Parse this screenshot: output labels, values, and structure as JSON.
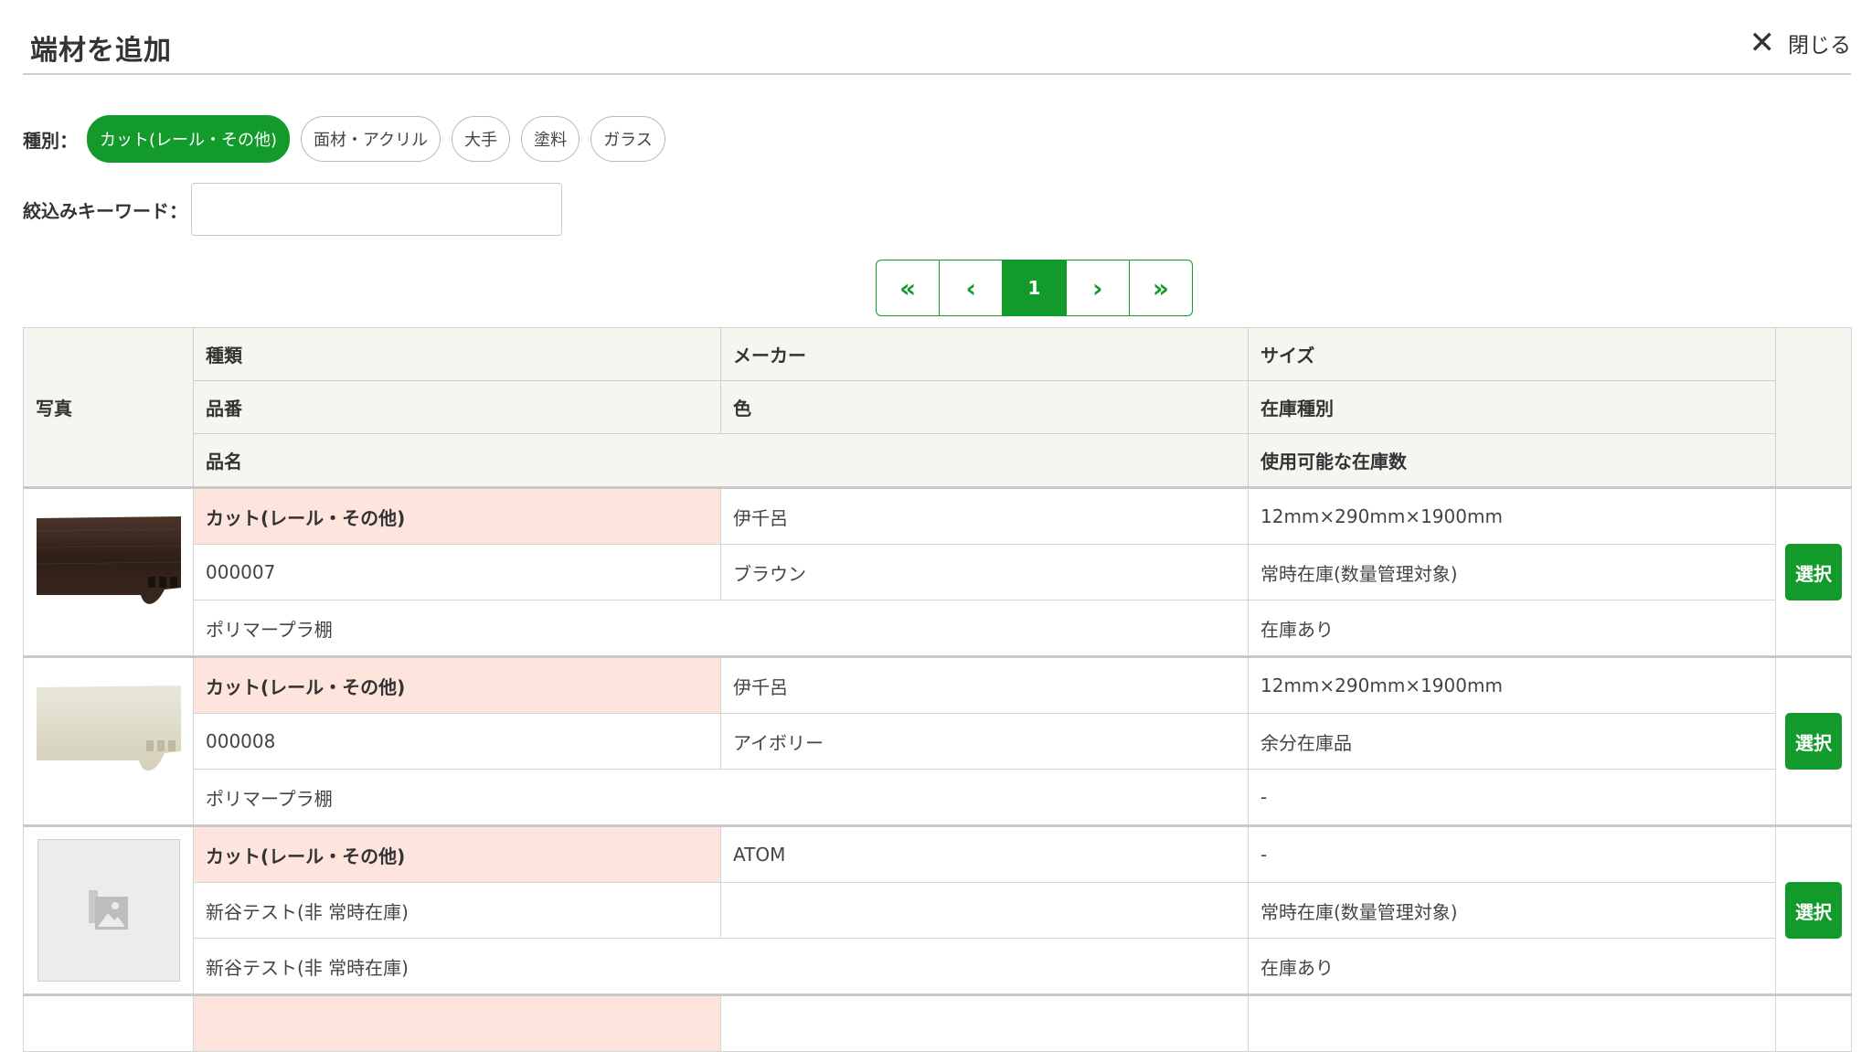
{
  "modal": {
    "title": "端材を追加",
    "close_label": "閉じる",
    "close_icon": "close-icon"
  },
  "filters": {
    "type_label": "種別：",
    "types": [
      {
        "label": "カット(レール・その他)",
        "active": true
      },
      {
        "label": "面材・アクリル",
        "active": false
      },
      {
        "label": "大手",
        "active": false
      },
      {
        "label": "塗料",
        "active": false
      },
      {
        "label": "ガラス",
        "active": false
      }
    ],
    "keyword_label": "絞込みキーワード：",
    "keyword_value": ""
  },
  "pagination": {
    "first": "«",
    "prev": "‹",
    "current": "1",
    "next": "›",
    "last": "»"
  },
  "table": {
    "headers": {
      "photo": "写真",
      "kind": "種類",
      "maker": "メーカー",
      "size": "サイズ",
      "part_no": "品番",
      "color": "色",
      "stock_type": "在庫種別",
      "name": "品名",
      "available": "使用可能な在庫数"
    },
    "rows": [
      {
        "photo": "brown-shelf-image",
        "kind": "カット(レール・その他)",
        "maker": "伊千呂",
        "size": "12mm×290mm×1900mm",
        "part_no": "000007",
        "color": "ブラウン",
        "stock_type": "常時在庫(数量管理対象)",
        "name": "ポリマープラ棚",
        "available": "在庫あり",
        "select": "選択"
      },
      {
        "photo": "ivory-shelf-image",
        "kind": "カット(レール・その他)",
        "maker": "伊千呂",
        "size": "12mm×290mm×1900mm",
        "part_no": "000008",
        "color": "アイボリー",
        "stock_type": "余分在庫品",
        "name": "ポリマープラ棚",
        "available": "-",
        "select": "選択"
      },
      {
        "photo": "image-placeholder-icon",
        "kind": "カット(レール・その他)",
        "maker": "ATOM",
        "size": "-",
        "part_no": "新谷テスト(非 常時在庫)",
        "color": "",
        "stock_type": "常時在庫(数量管理対象)",
        "name": "新谷テスト(非 常時在庫)",
        "available": "在庫あり",
        "select": "選択"
      }
    ]
  },
  "colors": {
    "accent": "#129a2a",
    "kind_highlight": "#fde4dc",
    "header_bg": "#f6f5ef"
  }
}
